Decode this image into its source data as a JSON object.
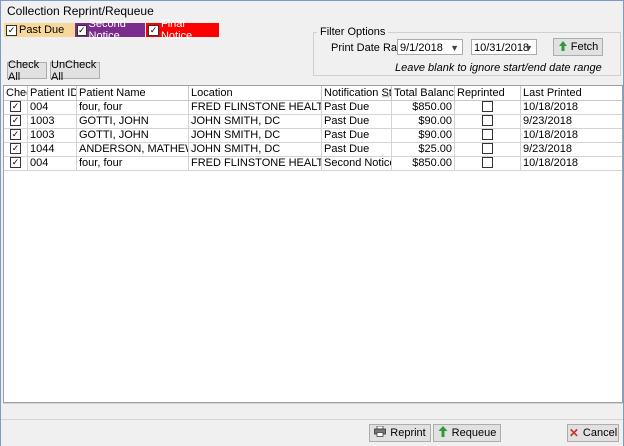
{
  "window": {
    "title": "Collection Reprint/Requeue"
  },
  "legend": [
    {
      "label": "Past Due",
      "bg": "#f8d89a",
      "fg": "#000000",
      "check": "✓"
    },
    {
      "label": "Second Notice",
      "bg": "#7b2c8c",
      "fg": "#ffffff",
      "check": "✓"
    },
    {
      "label": "Final Notice",
      "bg": "#ff0000",
      "fg": "#ffffff",
      "check": "✓"
    }
  ],
  "filter": {
    "title": "Filter Options",
    "date_range_label": "Print Date Range:",
    "start_date": "9/1/2018",
    "end_date": "10/31/2018",
    "fetch_label": "Fetch",
    "hint": "Leave blank to ignore start/end date range"
  },
  "buttons": {
    "check_all": "Check All",
    "uncheck_all": "UnCheck All",
    "reprint": "Reprint",
    "requeue": "Requeue",
    "cancel": "Cancel"
  },
  "grid": {
    "columns": [
      "Check",
      "Patient ID",
      "Patient Name",
      "Location",
      "Notification Sta",
      "Total Balance",
      "Reprinted",
      "Last Printed"
    ],
    "sort_indicator": "△",
    "rows": [
      {
        "checked": "✓",
        "patient_id": "004",
        "patient_name": "four, four",
        "location": "FRED FLINSTONE HEALTH ASSOCIATES",
        "status": "Past Due",
        "balance": "$850.00",
        "reprinted": "",
        "last_printed": "10/18/2018"
      },
      {
        "checked": "✓",
        "patient_id": "1003",
        "patient_name": "GOTTI, JOHN",
        "location": "JOHN SMITH, DC",
        "status": "Past Due",
        "balance": "$90.00",
        "reprinted": "",
        "last_printed": "9/23/2018"
      },
      {
        "checked": "✓",
        "patient_id": "1003",
        "patient_name": "GOTTI, JOHN",
        "location": "JOHN SMITH, DC",
        "status": "Past Due",
        "balance": "$90.00",
        "reprinted": "",
        "last_printed": "10/18/2018"
      },
      {
        "checked": "✓",
        "patient_id": "1044",
        "patient_name": "ANDERSON, MATHEW",
        "location": "JOHN SMITH, DC",
        "status": "Past Due",
        "balance": "$25.00",
        "reprinted": "",
        "last_printed": "9/23/2018"
      },
      {
        "checked": "✓",
        "patient_id": "004",
        "patient_name": "four, four",
        "location": "FRED FLINSTONE HEALTH ASSOCIATES",
        "status": "Second Notice",
        "balance": "$850.00",
        "reprinted": "",
        "last_printed": "10/18/2018"
      }
    ]
  }
}
